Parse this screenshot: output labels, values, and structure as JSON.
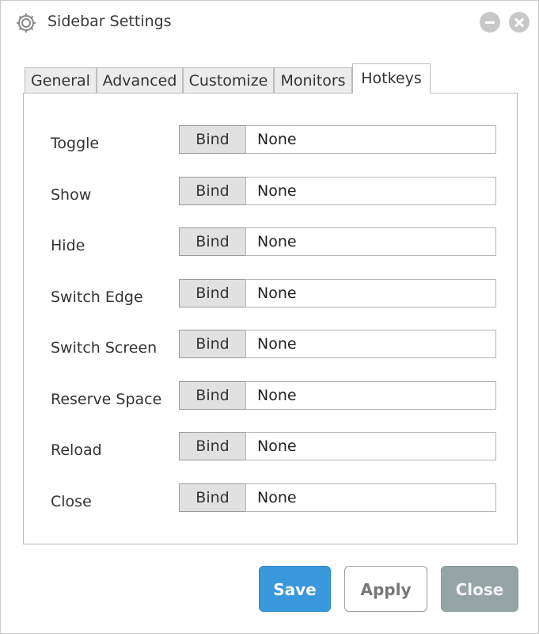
{
  "window": {
    "title": "Sidebar Settings",
    "icon": "gear-icon",
    "controls": [
      "minimize-icon",
      "close-icon"
    ]
  },
  "tabs": [
    {
      "label": "General",
      "active": false
    },
    {
      "label": "Advanced",
      "active": false
    },
    {
      "label": "Customize",
      "active": false
    },
    {
      "label": "Monitors",
      "active": false
    },
    {
      "label": "Hotkeys",
      "active": true
    }
  ],
  "hotkeys": [
    {
      "label": "Toggle",
      "button": "Bind",
      "value": "None"
    },
    {
      "label": "Show",
      "button": "Bind",
      "value": "None"
    },
    {
      "label": "Hide",
      "button": "Bind",
      "value": "None"
    },
    {
      "label": "Switch Edge",
      "button": "Bind",
      "value": "None"
    },
    {
      "label": "Switch Screen",
      "button": "Bind",
      "value": "None"
    },
    {
      "label": "Reserve Space",
      "button": "Bind",
      "value": "None"
    },
    {
      "label": "Reload",
      "button": "Bind",
      "value": "None"
    },
    {
      "label": "Close",
      "button": "Bind",
      "value": "None"
    }
  ],
  "footer": {
    "save_label": "Save",
    "apply_label": "Apply",
    "close_label": "Close"
  },
  "colors": {
    "save": "#3a98dc",
    "close": "#95a5a5",
    "bind_button": "#e1e1e1"
  }
}
